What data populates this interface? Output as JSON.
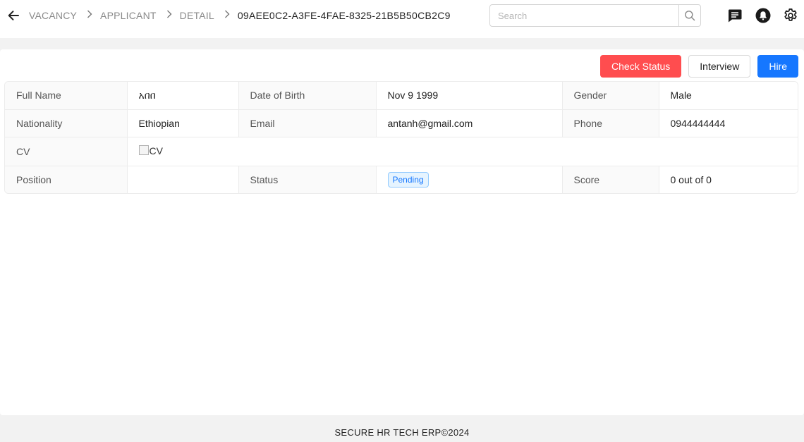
{
  "breadcrumb": {
    "items": [
      "VACANCY",
      "APPLICANT",
      "DETAIL"
    ],
    "current": "09AEE0C2-A3FE-4FAE-8325-21B5B50CB2C9"
  },
  "search": {
    "placeholder": "Search"
  },
  "icons": {
    "back": "arrow-left-icon",
    "search": "search-icon",
    "messages": "chat-icon",
    "notifications": "bell-icon",
    "settings": "gear-icon"
  },
  "actions": {
    "check_status": "Check Status",
    "interview": "Interview",
    "hire": "Hire"
  },
  "details": {
    "full_name_label": "Full Name",
    "full_name": "አበበ",
    "dob_label": "Date of Birth",
    "dob": "Nov 9 1999",
    "gender_label": "Gender",
    "gender": "Male",
    "nationality_label": "Nationality",
    "nationality": "Ethiopian",
    "email_label": "Email",
    "email": "antanh@gmail.com",
    "phone_label": "Phone",
    "phone": "0944444444",
    "cv_label": "CV",
    "cv_alt": "CV",
    "position_label": "Position",
    "position": "",
    "status_label": "Status",
    "status": "Pending",
    "score_label": "Score",
    "score": "0 out of 0"
  },
  "colors": {
    "danger": "#ff4d4f",
    "primary": "#1677ff",
    "tag_text": "#1677ff",
    "tag_bg": "#e6f4ff"
  },
  "footer": {
    "text": "SECURE HR TECH ERP©2024"
  }
}
